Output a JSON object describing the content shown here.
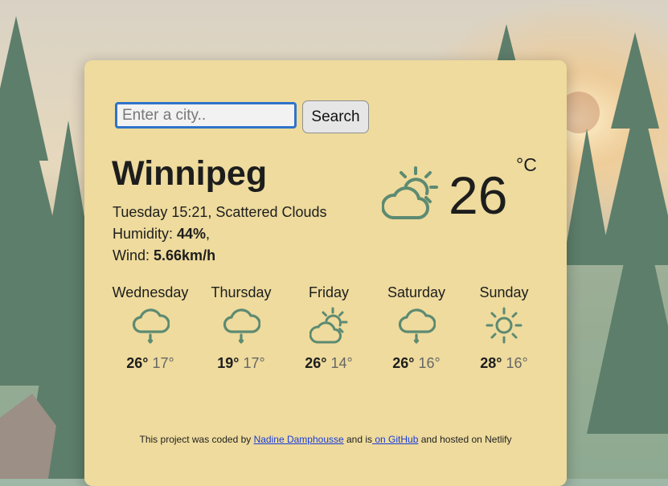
{
  "search": {
    "placeholder": "Enter a city..",
    "button_label": "Search"
  },
  "current": {
    "city": "Winnipeg",
    "datetime_description": "Tuesday 15:21, Scattered Clouds",
    "humidity_label": "Humidity: ",
    "humidity_value": "44%",
    "humidity_suffix": ",",
    "wind_label": "Wind: ",
    "wind_value": "5.66km/h",
    "temperature": "26",
    "unit": "°C",
    "icon": "partly-cloudy-icon"
  },
  "forecast": [
    {
      "day": "Wednesday",
      "icon": "rain-cloud-icon",
      "high": "26°",
      "low": "17°"
    },
    {
      "day": "Thursday",
      "icon": "rain-cloud-icon",
      "high": "19°",
      "low": "17°"
    },
    {
      "day": "Friday",
      "icon": "partly-cloudy-icon",
      "high": "26°",
      "low": "14°"
    },
    {
      "day": "Saturday",
      "icon": "rain-cloud-icon",
      "high": "26°",
      "low": "16°"
    },
    {
      "day": "Sunday",
      "icon": "sun-icon",
      "high": "28°",
      "low": "16°"
    }
  ],
  "footer": {
    "prefix": "This project was coded by ",
    "author_link": "Nadine Damphousse",
    "middle": " and is",
    "github_link": " on GitHub",
    "suffix": " and hosted on Netlify"
  },
  "colors": {
    "card_background": "#eedb9d",
    "icon_color": "#5d8a72",
    "link_color": "#1a3cd9",
    "input_border": "#2f73c9"
  }
}
